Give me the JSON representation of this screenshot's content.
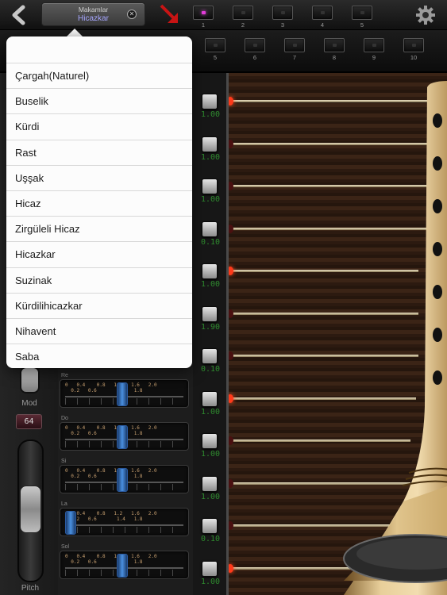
{
  "header": {
    "selector_label": "Makamlar",
    "selector_value": "Hicazkar",
    "preset_numbers_top": [
      "1",
      "2",
      "3",
      "4",
      "5"
    ],
    "preset_numbers_bottom": [
      "5",
      "6",
      "7",
      "8",
      "9",
      "10"
    ],
    "active_preset": "1",
    "accent_color": "#a6a6ff"
  },
  "dropdown": {
    "items": [
      "Çargah(Naturel)",
      "Buselik",
      "Kürdi",
      "Rast",
      "Uşşak",
      "Hicaz",
      "Zirgüleli Hicaz",
      "Hicazkar",
      "Suzinak",
      "Kürdilihicazkar",
      "Nihavent",
      "Saba"
    ]
  },
  "left_controls": {
    "mod_label": "Mod",
    "mod_value": "64",
    "pitch_label": "Pitch"
  },
  "strings": {
    "values": [
      "1.00",
      "1.00",
      "1.00",
      "0.10",
      "1.00",
      "1.90",
      "0.10",
      "1.00",
      "1.00",
      "1.00",
      "0.10",
      "1.00"
    ],
    "lit": [
      true,
      false,
      false,
      false,
      true,
      false,
      false,
      true,
      false,
      false,
      false,
      true
    ]
  },
  "note_rows": [
    {
      "label": "Re",
      "scale_top": "0   0.4    0.8   1.2   1.6   2.0",
      "scale_bottom": "  0.2   0.6       1.4   1.8",
      "thumb_value": 1.0
    },
    {
      "label": "Do",
      "scale_top": "0   0.4    0.8   1.2   1.6   2.0",
      "scale_bottom": "  0.2   0.6       1.4   1.8",
      "thumb_value": 1.0
    },
    {
      "label": "Si",
      "scale_top": "0   0.4    0.8   1.2   1.6   2.0",
      "scale_bottom": "  0.2   0.6       1.4   1.8",
      "thumb_value": 1.0
    },
    {
      "label": "La",
      "scale_top": "0   0.4    0.8   1.2   1.6   2.0",
      "scale_bottom": "  0.2   0.6       1.4   1.8",
      "thumb_value": 0.1
    },
    {
      "label": "Sol",
      "scale_top": "0   0.4    0.8   1.2   1.6   2.0",
      "scale_bottom": "  0.2   0.6       1.4   1.8",
      "thumb_value": 1.0
    }
  ]
}
